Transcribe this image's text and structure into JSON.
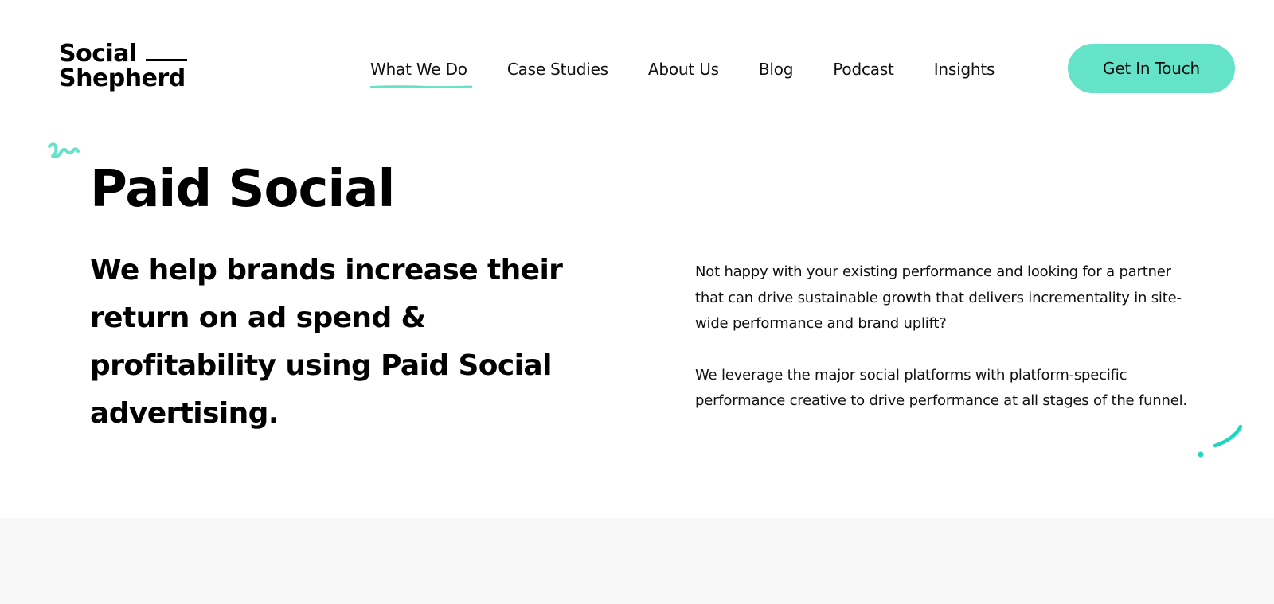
{
  "brand": {
    "logo_line1": "Social",
    "logo_line2": "Shepherd",
    "accent_color": "#64e3c8"
  },
  "nav": {
    "items": [
      {
        "label": "What We Do",
        "active": true
      },
      {
        "label": "Case Studies",
        "active": false
      },
      {
        "label": "About Us",
        "active": false
      },
      {
        "label": "Blog",
        "active": false
      },
      {
        "label": "Podcast",
        "active": false
      },
      {
        "label": "Insights",
        "active": false
      }
    ],
    "cta_label": "Get In Touch"
  },
  "hero": {
    "title": "Paid Social",
    "subtitle": "We help brands increase their return on ad spend & profitability using Paid Social advertising.",
    "paragraphs": [
      "Not happy with your existing performance and looking for a partner that can drive sustainable growth that delivers incrementality in site-wide performance and brand uplift?",
      "We leverage the major social platforms with platform-specific performance creative to drive performance at all stages of the funnel."
    ]
  },
  "decorations": {
    "squiggle_icon": "squiggle-icon",
    "swoosh_icon": "swoosh-icon"
  }
}
